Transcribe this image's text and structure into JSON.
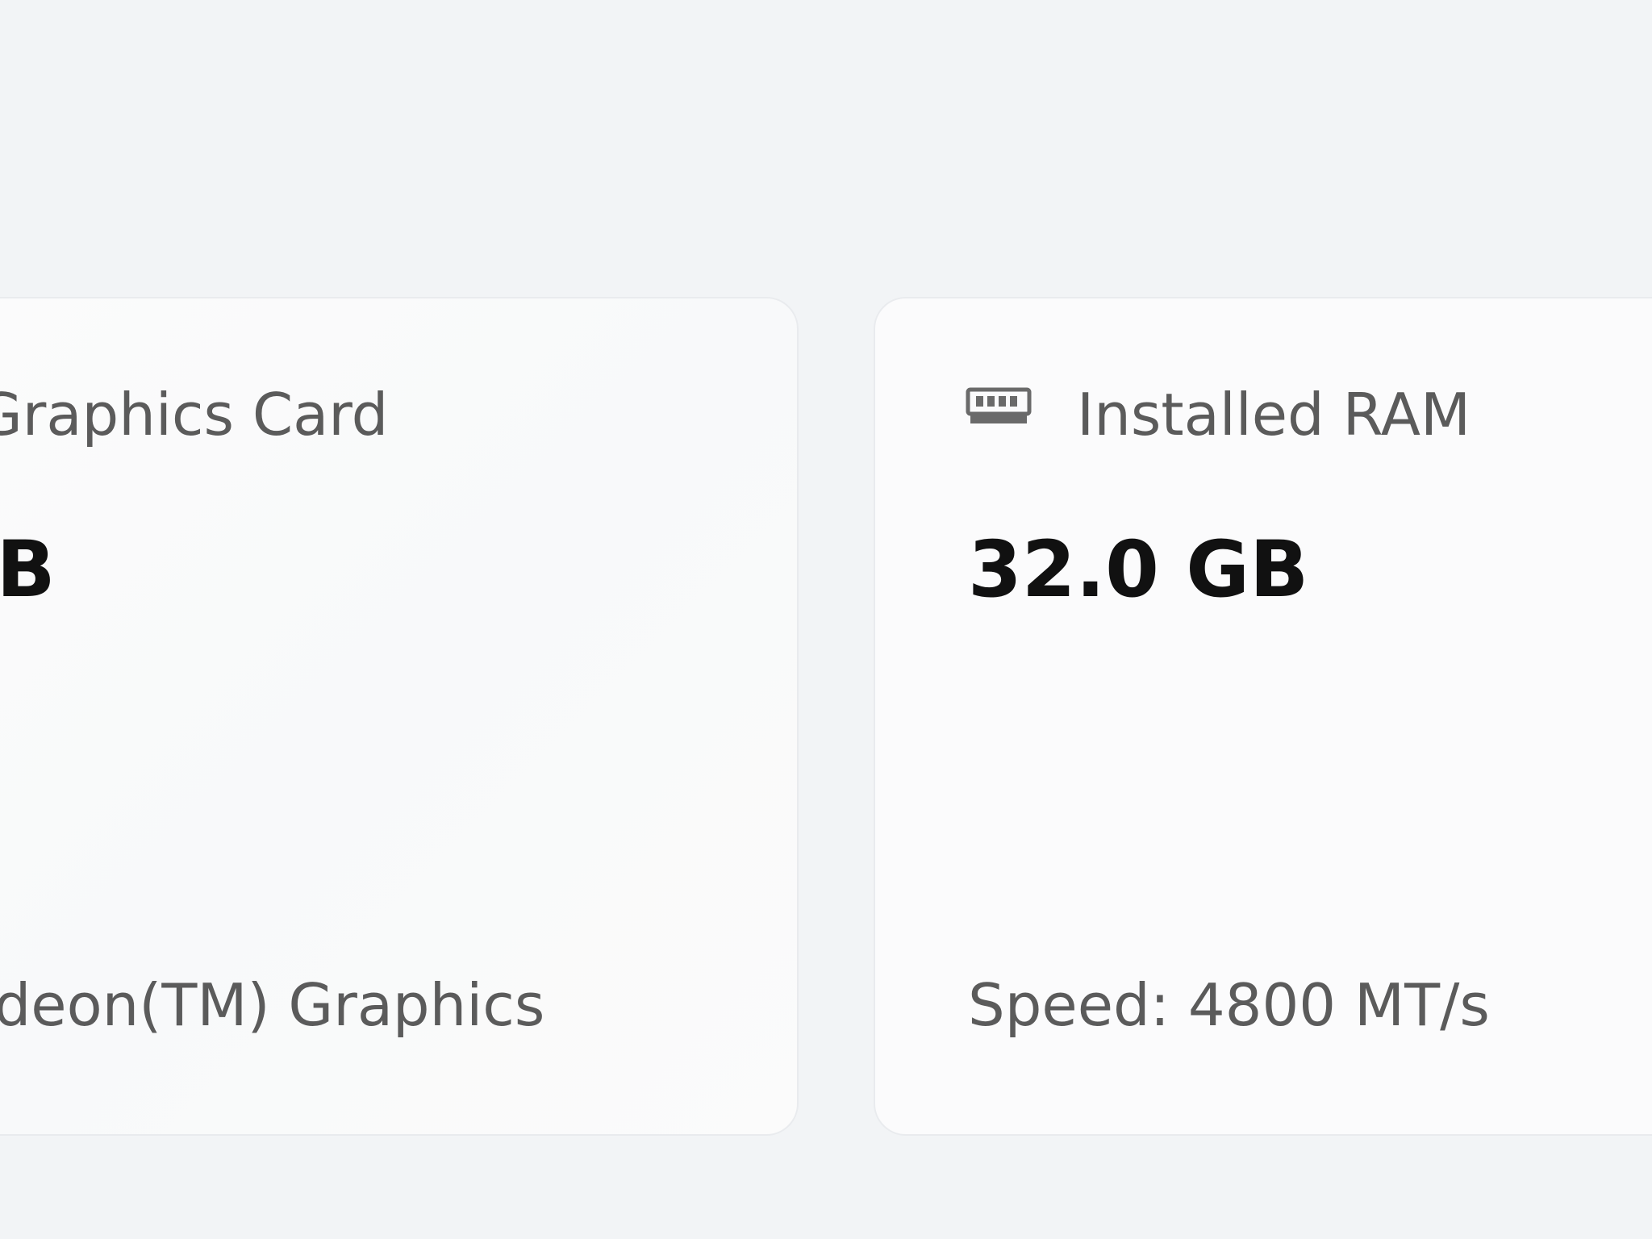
{
  "cards": {
    "graphics": {
      "label": "Graphics Card",
      "value": "MB",
      "detail": "Radeon(TM) Graphics"
    },
    "ram": {
      "icon": "ram-icon",
      "label": "Installed RAM",
      "value": "32.0 GB",
      "detail": "Speed: 4800 MT/s"
    }
  },
  "colors": {
    "background": "#f2f4f6",
    "card": "#fbfbfc",
    "value_text": "#111111",
    "secondary_text": "#5b5b5b"
  }
}
